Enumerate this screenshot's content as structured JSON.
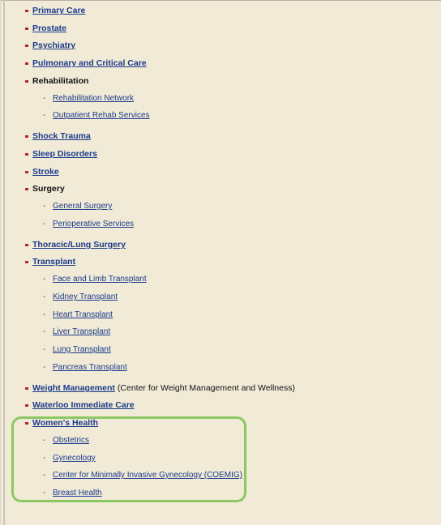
{
  "colors": {
    "background": "#f0ead6",
    "link": "#1b3a8c",
    "bullet": "#b0253a",
    "highlight_border": "#8cc862"
  },
  "items": [
    {
      "label": "Primary Care",
      "link": true,
      "icons": "square-bullet-icon"
    },
    {
      "label": "Prostate",
      "link": true
    },
    {
      "label": "Psychiatry",
      "link": true
    },
    {
      "label": "Pulmonary and Critical Care",
      "link": true
    },
    {
      "label": "Rehabilitation",
      "link": false,
      "children": [
        "Rehabilitation Network",
        "Outpatient Rehab Services"
      ]
    },
    {
      "label": "Shock Trauma",
      "link": true
    },
    {
      "label": "Sleep Disorders",
      "link": true
    },
    {
      "label": "Stroke",
      "link": true
    },
    {
      "label": "Surgery",
      "link": false,
      "children": [
        "General Surgery",
        "Perioperative Services"
      ]
    },
    {
      "label": "Thoracic/Lung Surgery",
      "link": true
    },
    {
      "label": "Transplant",
      "link": true,
      "children": [
        "Face and Limb Transplant",
        "Kidney Transplant",
        "Heart Transplant",
        "Liver Transplant",
        "Lung Transplant",
        "Pancreas Transplant"
      ]
    },
    {
      "label": "Weight Management",
      "link": true,
      "extra": "(Center for Weight Management and Wellness)"
    },
    {
      "label": "Waterloo Immediate Care",
      "link": true
    },
    {
      "label": "Women's Health",
      "link": true,
      "highlighted": true,
      "children": [
        "Obstetrics",
        "Gynecology",
        "Center for Minimally Invasive Gynecology (COEMIG)",
        "Breast Health"
      ]
    }
  ]
}
